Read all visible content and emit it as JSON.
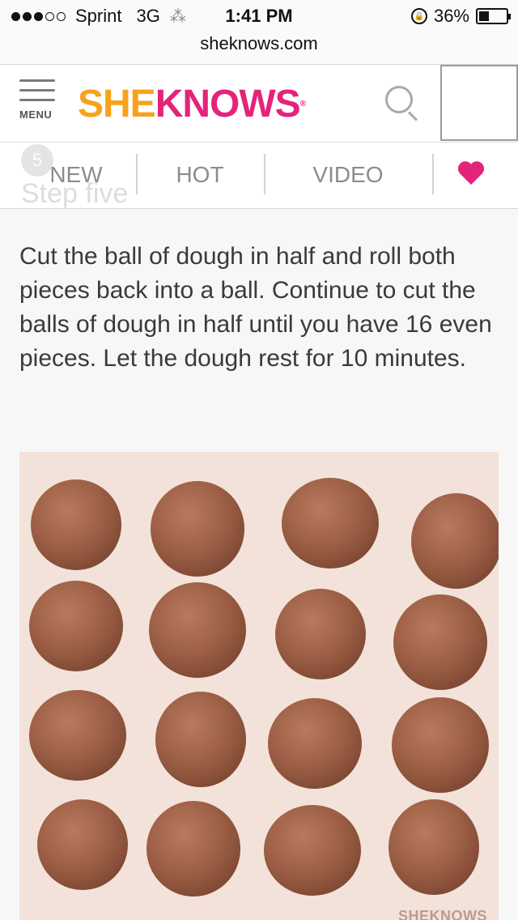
{
  "status_bar": {
    "carrier": "Sprint",
    "network": "3G",
    "time": "1:41 PM",
    "battery_label": "36%",
    "battery_level": 0.36,
    "signal_bars_filled": 3,
    "signal_bars_total": 5
  },
  "browser": {
    "url": "sheknows.com"
  },
  "header": {
    "menu_label": "MENU",
    "logo_she": "SHE",
    "logo_knows": "KNOWS",
    "logo_reg": "®"
  },
  "nav": {
    "items": [
      {
        "label": "NEW"
      },
      {
        "label": "HOT"
      },
      {
        "label": "VIDEO"
      }
    ],
    "heart_icon": "heart-icon",
    "heart_color": "#e4247b"
  },
  "step": {
    "number": "5",
    "title": "Step five"
  },
  "article": {
    "body": "Cut the ball of dough in half and roll both pieces back into a ball. Continue to cut the balls of dough in half until you have 16 even pieces. Let the dough rest for 10 minutes."
  },
  "photo": {
    "watermark": "SHEKNOWS"
  },
  "colors": {
    "brand_orange": "#f7a21b",
    "brand_pink": "#e4247b",
    "dough": "#a0624a"
  }
}
